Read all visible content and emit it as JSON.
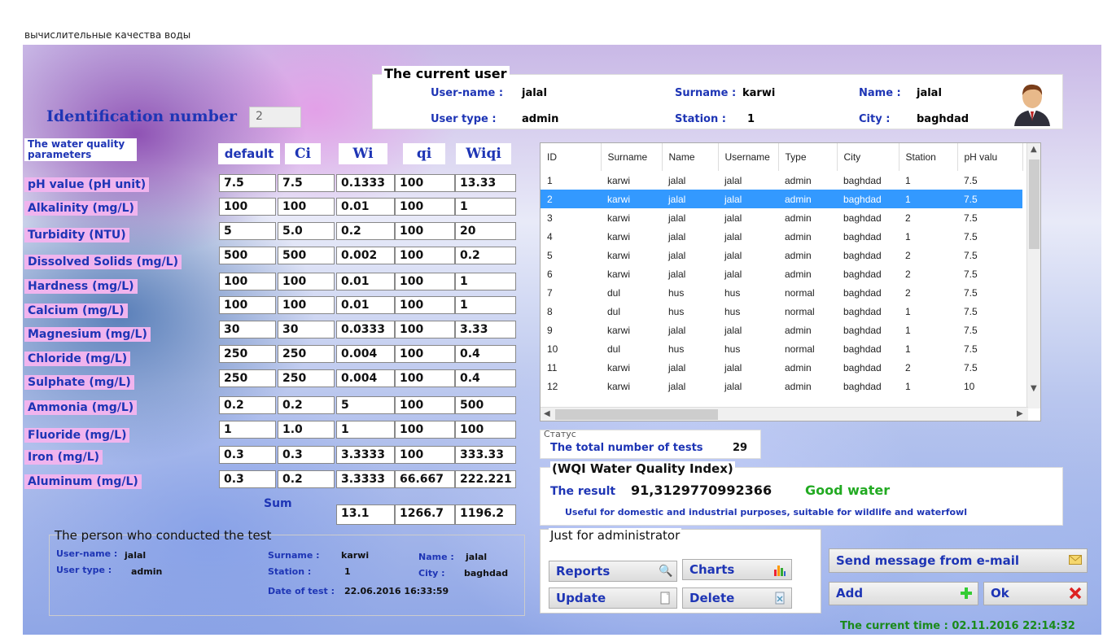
{
  "window": {
    "title": "вычислительные качества воды"
  },
  "identification": {
    "label": "Identification number",
    "value": "2"
  },
  "current_user": {
    "title": "The current user",
    "username_label": "User-name :",
    "username": "jalal",
    "surname_label": "Surname :",
    "surname": "karwi",
    "name_label": "Name :",
    "name": "jalal",
    "usertype_label": "User type :",
    "usertype": "admin",
    "station_label": "Station :",
    "station": "1",
    "city_label": "City :",
    "city": "baghdad"
  },
  "params": {
    "header_line1": "The water quality",
    "header_line2": "parameters",
    "columns": [
      "default",
      "Ci",
      "Wi",
      "qi",
      "Wiqi"
    ],
    "rows": [
      {
        "label": "pH value (pH unit)",
        "default": "7.5",
        "ci": "7.5",
        "wi": "0.1333",
        "qi": "100",
        "wiqi": "13.33"
      },
      {
        "label": "Alkalinity (mg/L)",
        "default": "100",
        "ci": "100",
        "wi": "0.01",
        "qi": "100",
        "wiqi": "1"
      },
      {
        "label": "Turbidity (NTU)",
        "default": "5",
        "ci": "5.0",
        "wi": "0.2",
        "qi": "100",
        "wiqi": "20"
      },
      {
        "label": "Dissolved Solids (mg/L)",
        "default": "500",
        "ci": "500",
        "wi": "0.002",
        "qi": "100",
        "wiqi": "0.2"
      },
      {
        "label": "Hardness (mg/L)",
        "default": "100",
        "ci": "100",
        "wi": "0.01",
        "qi": "100",
        "wiqi": "1"
      },
      {
        "label": "Calcium (mg/L)",
        "default": "100",
        "ci": "100",
        "wi": "0.01",
        "qi": "100",
        "wiqi": "1"
      },
      {
        "label": "Magnesium (mg/L)",
        "default": "30",
        "ci": "30",
        "wi": "0.0333",
        "qi": "100",
        "wiqi": "3.33"
      },
      {
        "label": "Chloride (mg/L)",
        "default": "250",
        "ci": "250",
        "wi": "0.004",
        "qi": "100",
        "wiqi": "0.4"
      },
      {
        "label": "Sulphate (mg/L)",
        "default": "250",
        "ci": "250",
        "wi": "0.004",
        "qi": "100",
        "wiqi": "0.4"
      },
      {
        "label": "Ammonia (mg/L)",
        "default": "0.2",
        "ci": "0.2",
        "wi": "5",
        "qi": "100",
        "wiqi": "500"
      },
      {
        "label": "Fluoride (mg/L)",
        "default": "1",
        "ci": "1.0",
        "wi": "1",
        "qi": "100",
        "wiqi": "100"
      },
      {
        "label": "Iron (mg/L)",
        "default": "0.3",
        "ci": "0.3",
        "wi": "3.3333",
        "qi": "100",
        "wiqi": "333.33"
      },
      {
        "label": "Aluminum (mg/L)",
        "default": "0.3",
        "ci": "0.2",
        "wi": "3.3333",
        "qi": "66.667",
        "wiqi": "222.221"
      }
    ],
    "sum_label": "Sum",
    "sum": {
      "wi": "13.1",
      "qi": "1266.7",
      "wiqi": "1196.2"
    }
  },
  "grid": {
    "columns": [
      "ID",
      "Surname",
      "Name",
      "Username",
      "Type",
      "City",
      "Station",
      "pH valu"
    ],
    "rows": [
      [
        "1",
        "karwi",
        "jalal",
        "jalal",
        "admin",
        "baghdad",
        "1",
        "7.5"
      ],
      [
        "2",
        "karwi",
        "jalal",
        "jalal",
        "admin",
        "baghdad",
        "1",
        "7.5"
      ],
      [
        "3",
        "karwi",
        "jalal",
        "jalal",
        "admin",
        "baghdad",
        "2",
        "7.5"
      ],
      [
        "4",
        "karwi",
        "jalal",
        "jalal",
        "admin",
        "baghdad",
        "1",
        "7.5"
      ],
      [
        "5",
        "karwi",
        "jalal",
        "jalal",
        "admin",
        "baghdad",
        "2",
        "7.5"
      ],
      [
        "6",
        "karwi",
        "jalal",
        "jalal",
        "admin",
        "baghdad",
        "2",
        "7.5"
      ],
      [
        "7",
        "dul",
        "hus",
        "hus",
        "normal",
        "baghdad",
        "2",
        "7.5"
      ],
      [
        "8",
        "dul",
        "hus",
        "hus",
        "normal",
        "baghdad",
        "1",
        "7.5"
      ],
      [
        "9",
        "karwi",
        "jalal",
        "jalal",
        "admin",
        "baghdad",
        "1",
        "7.5"
      ],
      [
        "10",
        "dul",
        "hus",
        "hus",
        "normal",
        "baghdad",
        "1",
        "7.5"
      ],
      [
        "11",
        "karwi",
        "jalal",
        "jalal",
        "admin",
        "baghdad",
        "2",
        "7.5"
      ],
      [
        "12",
        "karwi",
        "jalal",
        "jalal",
        "admin",
        "baghdad",
        "1",
        "10"
      ]
    ],
    "selected_id": "2"
  },
  "status": {
    "legend": "Статус",
    "total_label": "The total number of tests",
    "total": "29"
  },
  "wqi": {
    "title": "(WQI Water Quality Index)",
    "result_label": "The result",
    "result": "91,3129770992366",
    "verdict": "Good water",
    "description": "Useful for domestic and industrial purposes, suitable for wildlife and waterfowl",
    "verdict_color": "#22aa22"
  },
  "admin": {
    "legend": "Just for administrator",
    "reports": "Reports",
    "charts": "Charts",
    "update": "Update",
    "delete": "Delete"
  },
  "actions": {
    "send_mail": "Send message from e-mail",
    "add": "Add",
    "ok": "Ok"
  },
  "person": {
    "legend": "The person who conducted the test",
    "username_label": "User-name :",
    "username": "jalal",
    "usertype_label": "User type :",
    "usertype": "admin",
    "surname_label": "Surname :",
    "surname": "karwi",
    "station_label": "Station :",
    "station": "1",
    "name_label": "Name :",
    "name": "jalal",
    "city_label": "City :",
    "city": "baghdad",
    "date_label": "Date of test :",
    "date": "22.06.2016 16:33:59"
  },
  "clock": {
    "text": "The current time : 02.11.2016 22:14:32"
  },
  "colors": {
    "accent": "#1e35b5",
    "label_bg": "#f0b4ee",
    "selection": "#3399ff"
  }
}
